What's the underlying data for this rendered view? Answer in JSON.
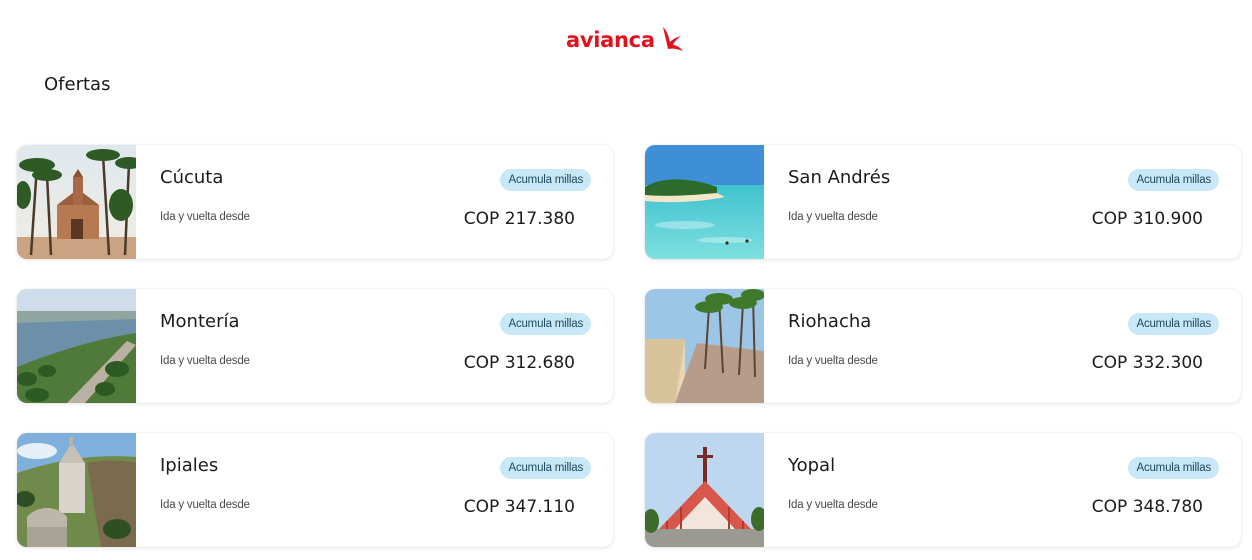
{
  "brand": {
    "name": "avianca",
    "color": "#e1111d",
    "logo_icon": "bird-icon"
  },
  "section": {
    "title": "Ofertas"
  },
  "badge_color": "#c8e8f7",
  "offers": [
    {
      "city": "Cúcuta",
      "badge": "Acumula millas",
      "subtitle": "Ida y vuelta desde",
      "price": "COP 217.380",
      "image": "cucuta-cathedral-palms"
    },
    {
      "city": "San Andrés",
      "badge": "Acumula millas",
      "subtitle": "Ida y vuelta desde",
      "price": "COP 310.900",
      "image": "san-andres-beach"
    },
    {
      "city": "Montería",
      "badge": "Acumula millas",
      "subtitle": "Ida y vuelta desde",
      "price": "COP 312.680",
      "image": "monteria-river"
    },
    {
      "city": "Riohacha",
      "badge": "Acumula millas",
      "subtitle": "Ida y vuelta desde",
      "price": "COP 332.300",
      "image": "riohacha-boardwalk"
    },
    {
      "city": "Ipiales",
      "badge": "Acumula millas",
      "subtitle": "Ida y vuelta desde",
      "price": "COP 347.110",
      "image": "ipiales-sanctuary"
    },
    {
      "city": "Yopal",
      "badge": "Acumula millas",
      "subtitle": "Ida y vuelta desde",
      "price": "COP 348.780",
      "image": "yopal-cathedral"
    }
  ]
}
